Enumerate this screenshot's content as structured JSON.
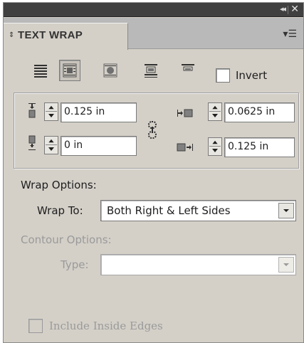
{
  "window": {
    "collapse_glyph": "◂◂",
    "close_glyph": "✕",
    "collapse_icon": "collapse-arrows-icon",
    "close_icon": "close-icon"
  },
  "tab": {
    "label": "TEXT WRAP",
    "sort_glyph": "⇕",
    "menu_glyph": "▾☰"
  },
  "wrap_buttons": [
    {
      "name": "no-text-wrap",
      "icon": "no-wrap-icon",
      "selected": false
    },
    {
      "name": "wrap-around-bounding-box",
      "icon": "bounding-box-wrap-icon",
      "selected": true
    },
    {
      "name": "wrap-around-object-shape",
      "icon": "object-shape-wrap-icon",
      "selected": false
    },
    {
      "name": "jump-object",
      "icon": "jump-object-icon",
      "selected": false
    },
    {
      "name": "jump-to-next-column",
      "icon": "jump-next-column-icon",
      "selected": false
    }
  ],
  "invert": {
    "label": "Invert",
    "checked": false
  },
  "offsets": {
    "top": "0.125 in",
    "bottom": "0 in",
    "left": "0.0625 in",
    "right": "0.125 in"
  },
  "wrap_options": {
    "section_label": "Wrap Options:",
    "wrap_to_label": "Wrap To:",
    "wrap_to_value": "Both Right & Left Sides"
  },
  "contour_options": {
    "section_label": "Contour Options:",
    "type_label": "Type:",
    "type_value": ""
  },
  "include_inside_edges": {
    "label": "Include Inside Edges",
    "checked": false
  },
  "colors": {
    "panel_bg": "#d4d0c8",
    "titlebar_bg": "#404040",
    "disabled_text": "#9a9a9a",
    "icon_dark": "#303030"
  }
}
